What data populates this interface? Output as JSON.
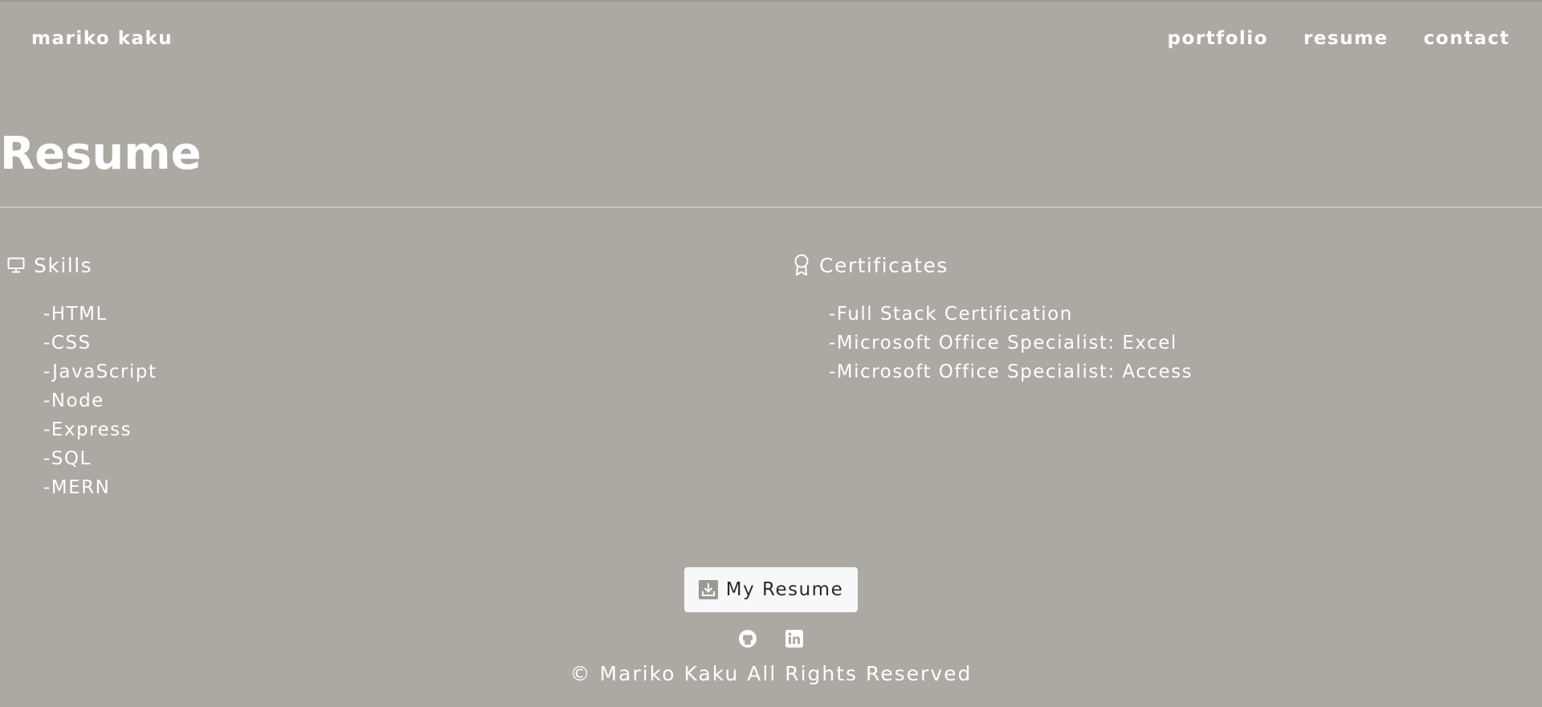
{
  "nav": {
    "brand": "mariko kaku",
    "links": [
      {
        "label": "portfolio"
      },
      {
        "label": "resume"
      },
      {
        "label": "contact"
      }
    ]
  },
  "page": {
    "title": "Resume"
  },
  "skills": {
    "title": "Skills",
    "icon": "monitor-icon",
    "items": [
      "-HTML",
      "-CSS",
      "-JavaScript",
      "-Node",
      "-Express",
      "-SQL",
      "-MERN"
    ]
  },
  "certificates": {
    "title": "Certificates",
    "icon": "award-icon",
    "items": [
      "-Full Stack Certification",
      "-Microsoft Office Specialist: Excel",
      "-Microsoft Office Specialist: Access"
    ]
  },
  "footer": {
    "resume_button_label": "My Resume",
    "resume_button_icon": "download-icon",
    "social_icons": [
      "github-icon",
      "linkedin-icon"
    ],
    "copyright": "© Mariko Kaku All Rights Reserved"
  },
  "colors": {
    "background": "#aca8a2",
    "text": "#ffffff",
    "button_bg": "#f7f8fa",
    "button_text": "#2b2b2b"
  }
}
